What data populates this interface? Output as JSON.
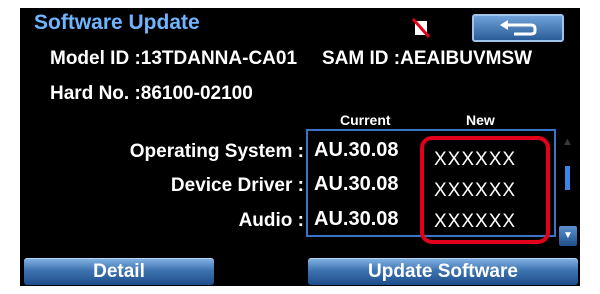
{
  "header": {
    "title": "Software Update",
    "back_icon": "back-arrow-icon",
    "status_icon": "no-sound-icon"
  },
  "info": {
    "model_id_label": "Model ID :",
    "model_id_value": "13TDANNA-CA01",
    "sam_id_label": "SAM ID :",
    "sam_id_value": "AEAIBUVMSW",
    "hard_no_label": "Hard No. :",
    "hard_no_value": "86100-02100"
  },
  "table": {
    "col_current": "Current",
    "col_new": "New",
    "rows": [
      {
        "label": "Operating System :",
        "current": "AU.30.08",
        "new": "XXXXXX"
      },
      {
        "label": "Device Driver :",
        "current": "AU.30.08",
        "new": "XXXXXX"
      },
      {
        "label": "Audio :",
        "current": "AU.30.08",
        "new": "XXXXXX"
      }
    ]
  },
  "buttons": {
    "detail": "Detail",
    "update": "Update Software"
  },
  "colors": {
    "title": "#6fb4ff",
    "highlight": "#e3001b",
    "accent": "#3a74c8"
  }
}
